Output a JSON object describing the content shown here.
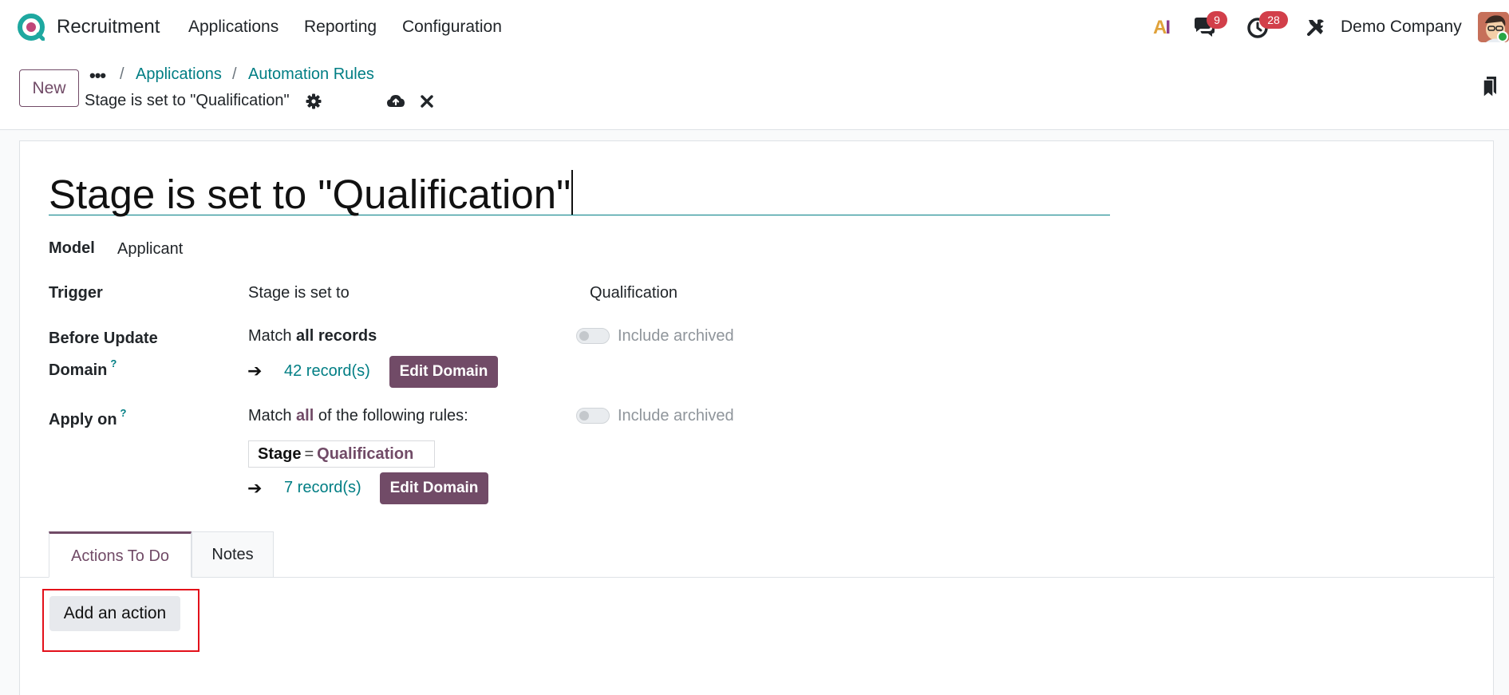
{
  "navbar": {
    "app_name": "Recruitment",
    "menu": [
      "Applications",
      "Reporting",
      "Configuration"
    ],
    "ai_label": {
      "a": "A",
      "i": "I"
    },
    "messages_count": "9",
    "activities_count": "28",
    "company": "Demo Company",
    "icons": [
      "recruitment-logo-icon",
      "ai-icon",
      "chat-icon",
      "clock-icon",
      "tools-icon",
      "avatar"
    ]
  },
  "control": {
    "new_label": "New",
    "more_label": "•••",
    "breadcrumbs": [
      "Applications",
      "Automation Rules"
    ],
    "separator": "/",
    "record_title": "Stage is set to \"Qualification\"",
    "icons": [
      "gear-icon",
      "cloud-upload-icon",
      "close-icon",
      "bookmark-icon"
    ]
  },
  "form": {
    "name": "Stage is set to \"Qualification\"",
    "model_label": "Model",
    "model_value": "Applicant",
    "trigger_label": "Trigger",
    "trigger_value": "Stage is set to",
    "trigger_stage": "Qualification",
    "before_label_line1": "Before Update",
    "before_label_line2": "Domain",
    "help_mark": "?",
    "before_match_prefix": "Match ",
    "before_match_bold": "all records",
    "arrow": "➔",
    "before_count": "42 record(s)",
    "edit_domain_label": "Edit Domain",
    "include_archived_label": "Include archived",
    "apply_label": "Apply on",
    "apply_match_prefix": "Match ",
    "apply_match_bold": "all",
    "apply_match_suffix": " of the following rules:",
    "rule": {
      "field": "Stage",
      "operator": "=",
      "value": "Qualification"
    },
    "apply_count": "7 record(s)"
  },
  "tabs": {
    "items": [
      "Actions To Do",
      "Notes"
    ],
    "active": "Actions To Do"
  },
  "actions": {
    "add_label": "Add an action"
  },
  "colors": {
    "brand": "#714b67",
    "link": "#017e84",
    "badge": "#d23f4a",
    "highlight": "#e3101a"
  }
}
